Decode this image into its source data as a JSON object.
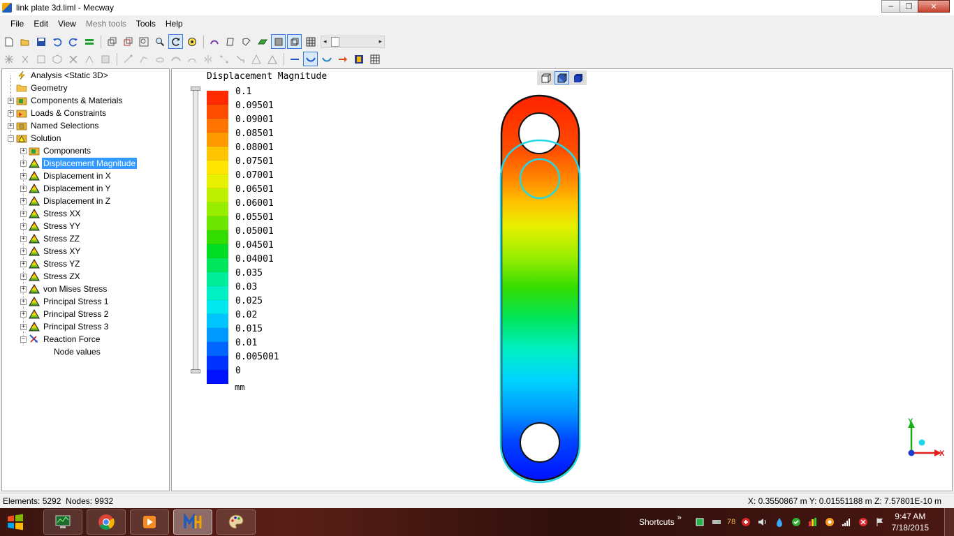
{
  "window": {
    "title": "link plate 3d.liml - Mecway",
    "minimize": "–",
    "maximize": "❐",
    "close": "✕"
  },
  "menu": [
    {
      "label": "File",
      "enabled": true
    },
    {
      "label": "Edit",
      "enabled": true
    },
    {
      "label": "View",
      "enabled": true
    },
    {
      "label": "Mesh tools",
      "enabled": false
    },
    {
      "label": "Tools",
      "enabled": true
    },
    {
      "label": "Help",
      "enabled": true
    }
  ],
  "tree": {
    "nodes": [
      {
        "label": "Analysis <Static 3D>",
        "icon": "lightning-icon",
        "level": 0,
        "expander": "none"
      },
      {
        "label": "Geometry",
        "icon": "folder-icon",
        "level": 0,
        "expander": "none"
      },
      {
        "label": "Components & Materials",
        "icon": "components-icon",
        "level": 0,
        "expander": "+"
      },
      {
        "label": "Loads & Constraints",
        "icon": "loads-icon",
        "level": 0,
        "expander": "+"
      },
      {
        "label": "Named Selections",
        "icon": "named-selection-icon",
        "level": 0,
        "expander": "+"
      },
      {
        "label": "Solution",
        "icon": "solution-icon",
        "level": 0,
        "expander": "-"
      },
      {
        "label": "Components",
        "icon": "components-icon",
        "level": 1,
        "expander": "+"
      },
      {
        "label": "Displacement Magnitude",
        "icon": "result-icon",
        "level": 1,
        "expander": "+",
        "selected": true
      },
      {
        "label": "Displacement in X",
        "icon": "result-icon",
        "level": 1,
        "expander": "+"
      },
      {
        "label": "Displacement in Y",
        "icon": "result-icon",
        "level": 1,
        "expander": "+"
      },
      {
        "label": "Displacement in Z",
        "icon": "result-icon",
        "level": 1,
        "expander": "+"
      },
      {
        "label": "Stress XX",
        "icon": "result-icon",
        "level": 1,
        "expander": "+"
      },
      {
        "label": "Stress YY",
        "icon": "result-icon",
        "level": 1,
        "expander": "+"
      },
      {
        "label": "Stress ZZ",
        "icon": "result-icon",
        "level": 1,
        "expander": "+"
      },
      {
        "label": "Stress XY",
        "icon": "result-icon",
        "level": 1,
        "expander": "+"
      },
      {
        "label": "Stress YZ",
        "icon": "result-icon",
        "level": 1,
        "expander": "+"
      },
      {
        "label": "Stress ZX",
        "icon": "result-icon",
        "level": 1,
        "expander": "+"
      },
      {
        "label": "von Mises Stress",
        "icon": "result-icon",
        "level": 1,
        "expander": "+"
      },
      {
        "label": "Principal Stress 1",
        "icon": "result-icon",
        "level": 1,
        "expander": "+"
      },
      {
        "label": "Principal Stress 2",
        "icon": "result-icon",
        "level": 1,
        "expander": "+"
      },
      {
        "label": "Principal Stress 3",
        "icon": "result-icon",
        "level": 1,
        "expander": "+"
      },
      {
        "label": "Reaction Force",
        "icon": "reaction-force-icon",
        "level": 1,
        "expander": "-"
      },
      {
        "label": "Node values",
        "icon": "",
        "level": 2,
        "expander": "none"
      }
    ]
  },
  "legend": {
    "title": "Displacement Magnitude",
    "unit": "mm",
    "values": [
      "0.1",
      "0.09501",
      "0.09001",
      "0.08501",
      "0.08001",
      "0.07501",
      "0.07001",
      "0.06501",
      "0.06001",
      "0.05501",
      "0.05001",
      "0.04501",
      "0.04001",
      "0.035",
      "0.03",
      "0.025",
      "0.02",
      "0.015",
      "0.01",
      "0.005001",
      "0"
    ],
    "colors": [
      "#ff2a00",
      "#ff4d00",
      "#ff7300",
      "#ff9900",
      "#ffc400",
      "#ffe600",
      "#e6f000",
      "#bff000",
      "#99ee00",
      "#6ce600",
      "#33dd00",
      "#00dd22",
      "#00e65c",
      "#00ee99",
      "#00f0c4",
      "#00e8ee",
      "#00c4ff",
      "#0099ff",
      "#0066ff",
      "#0033ff",
      "#0011ff"
    ]
  },
  "axes": {
    "x_label": "X",
    "y_label": "Y"
  },
  "status": {
    "elements": "Elements:  5292",
    "nodes": "Nodes: 9932",
    "coords": "X: 0.3550867 m Y: 0.01551188 m Z: 7.57801E-10 m"
  },
  "taskbar": {
    "shortcuts_label": "Shortcuts",
    "shortcuts_chevron": "»",
    "temp": "78",
    "time": "9:47 AM",
    "date": "7/18/2015"
  }
}
